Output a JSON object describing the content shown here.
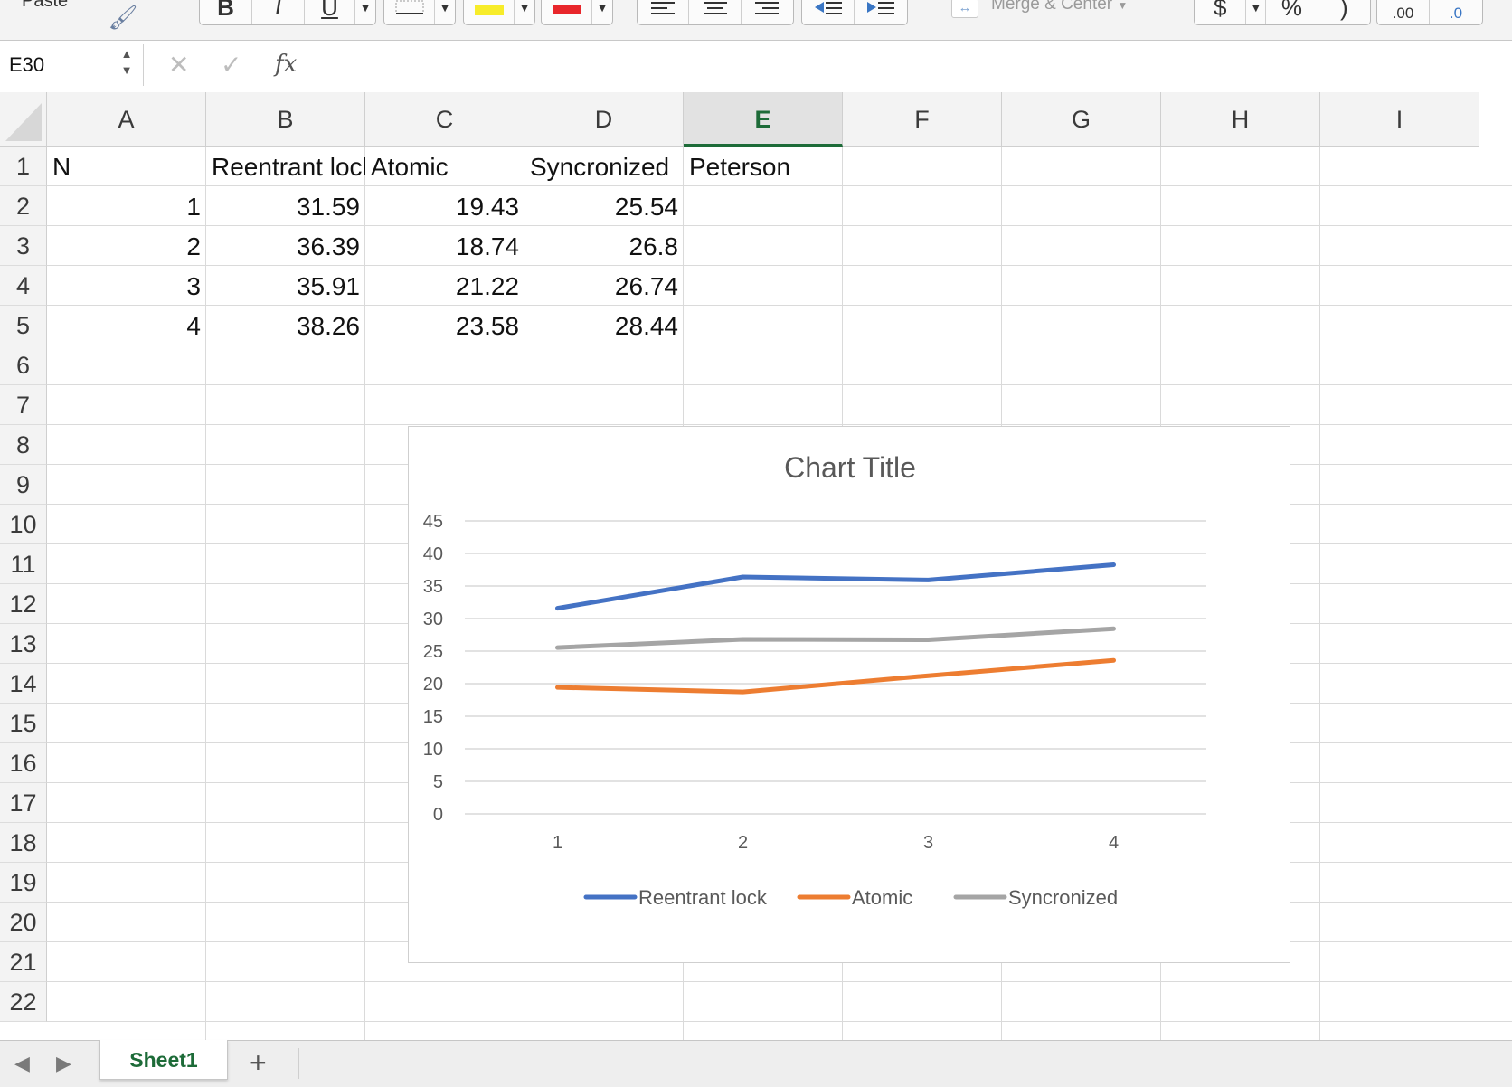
{
  "ribbon": {
    "paste_label": "Paste",
    "bold": "B",
    "italic": "I",
    "underline": "U",
    "merge_label": "Merge & Center",
    "currency": "$",
    "percent": "%",
    "comma": ")",
    "inc_decimal": ".00",
    "dec_decimal": ".0",
    "font_color": "#e8262b",
    "fill_color": "#f7ec2a"
  },
  "formula_bar": {
    "name_box": "E30",
    "fx": "fx",
    "formula": ""
  },
  "columns": [
    "A",
    "B",
    "C",
    "D",
    "E",
    "F",
    "G",
    "H",
    "I"
  ],
  "selected_column": "E",
  "rows": [
    "1",
    "2",
    "3",
    "4",
    "5",
    "6",
    "7",
    "8",
    "9",
    "10",
    "11",
    "12",
    "13",
    "14",
    "15",
    "16",
    "17",
    "18",
    "19",
    "20",
    "21",
    "22"
  ],
  "sheet": {
    "header": [
      "N",
      "Reentrant lock",
      "Atomic",
      "Syncronized",
      "Peterson"
    ],
    "data": [
      [
        "1",
        "31.59",
        "19.43",
        "25.54"
      ],
      [
        "2",
        "36.39",
        "18.74",
        "26.8"
      ],
      [
        "3",
        "35.91",
        "21.22",
        "26.74"
      ],
      [
        "4",
        "38.26",
        "23.58",
        "28.44"
      ]
    ]
  },
  "chart_data": {
    "type": "line",
    "title": "Chart Title",
    "x": [
      1,
      2,
      3,
      4
    ],
    "categories": [
      "1",
      "2",
      "3",
      "4"
    ],
    "ylim": [
      0,
      45
    ],
    "yticks": [
      0,
      5,
      10,
      15,
      20,
      25,
      30,
      35,
      40,
      45
    ],
    "ytick_labels": [
      "0",
      "5",
      "10",
      "15",
      "20",
      "25",
      "30",
      "35",
      "40",
      "45"
    ],
    "grid": true,
    "legend": "bottom",
    "series": [
      {
        "name": "Reentrant lock",
        "values": [
          31.59,
          36.39,
          35.91,
          38.26
        ],
        "color": "#4472c4"
      },
      {
        "name": "Atomic",
        "values": [
          19.43,
          18.74,
          21.22,
          23.58
        ],
        "color": "#ed7d31"
      },
      {
        "name": "Syncronized",
        "values": [
          25.54,
          26.8,
          26.74,
          28.44
        ],
        "color": "#a5a5a5"
      }
    ]
  },
  "tabs": {
    "sheets": [
      "Sheet1"
    ],
    "add_label": "+"
  },
  "icons": {
    "format_painter": "paintbrush-icon",
    "cancel": "close-icon",
    "enter": "check-icon",
    "nav_prev": "triangle-left-icon",
    "nav_next": "triangle-right-icon"
  }
}
